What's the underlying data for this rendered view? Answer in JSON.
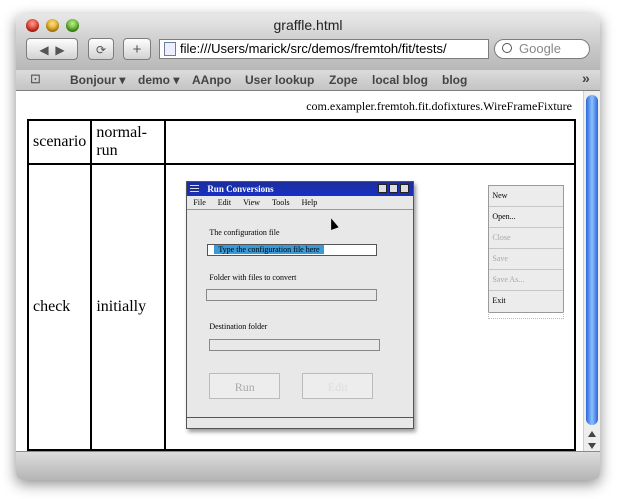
{
  "window": {
    "title": "graffle.html"
  },
  "toolbar": {
    "back_label": "◀",
    "forward_label": "▶",
    "reload_label": "⟳",
    "add_label": "+",
    "url": "file:///Users/marick/src/demos/fremtoh/fit/tests/",
    "search_placeholder": "Google"
  },
  "bookmarks": {
    "items": [
      "Bonjour ▾",
      "demo ▾",
      "AAnpo",
      "User lookup",
      "Zope",
      "local blog",
      "blog"
    ],
    "overflow": "»",
    "book_icon": "book-icon"
  },
  "page": {
    "fixture_name": "com.exampler.fremtoh.fit.dofixtures.WireFrameFixture",
    "table": {
      "row1": [
        "scenario",
        "normal-run"
      ],
      "row2": [
        "check",
        "initially"
      ]
    }
  },
  "dialog": {
    "title": "Run Conversions",
    "menu": [
      "File",
      "Edit",
      "View",
      "Tools",
      "Help"
    ],
    "config_label": "The configuration file",
    "config_value": "Type the configuration file here",
    "folder_label": "Folder with files to convert",
    "dest_label": "Destination folder",
    "run_label": "Run",
    "edit_label": "Edit"
  },
  "file_menu": {
    "items": [
      "New",
      "Open...",
      "Close",
      "Save",
      "Save As...",
      "Exit"
    ],
    "enabled": [
      true,
      true,
      false,
      false,
      false,
      true
    ]
  }
}
